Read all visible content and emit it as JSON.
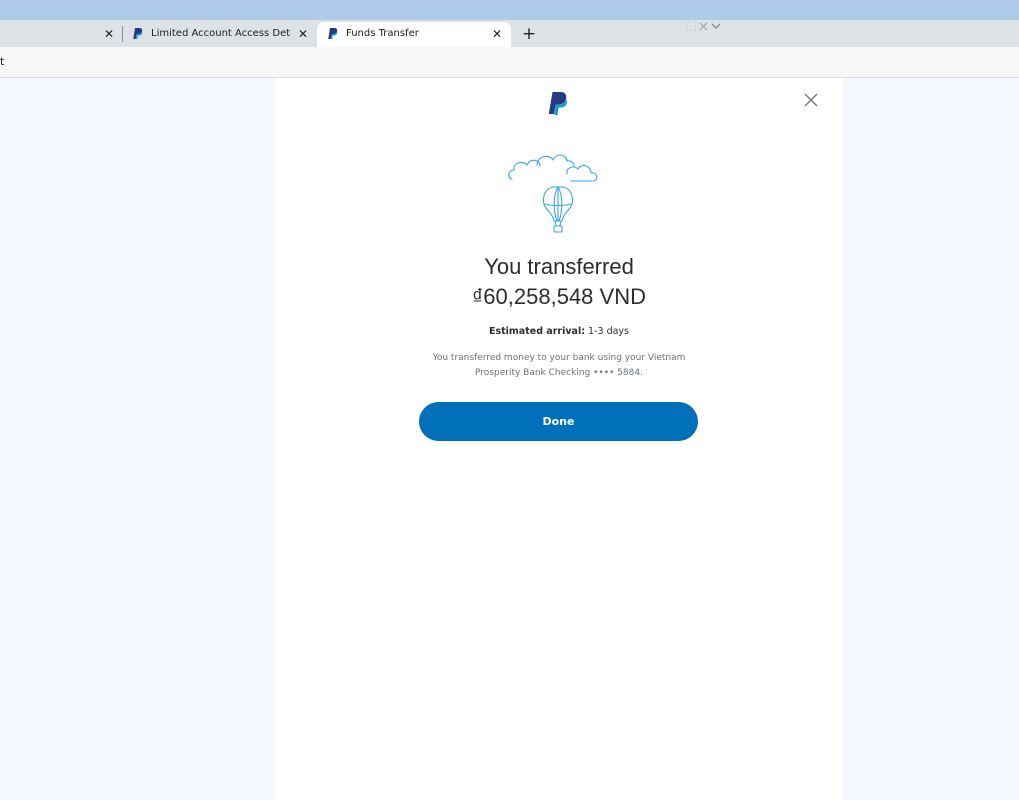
{
  "browser": {
    "tabs": [
      {
        "title": "",
        "close": "✕"
      },
      {
        "title": "Limited Account Access Details -",
        "close": "✕"
      },
      {
        "title": "Funds Transfer",
        "close": "✕",
        "active": true
      }
    ],
    "new_tab": "+",
    "address_text": "t"
  },
  "dialog": {
    "close_icon": "close-icon",
    "heading_line1": "You transferred",
    "heading_line2": "₫60,258,548 VND",
    "arrival_label": "Estimated arrival:",
    "arrival_value": "1-3 days",
    "description": "You transferred money to your bank using your Vietnam Prosperity Bank Checking •••• 5884.",
    "done_label": "Done"
  },
  "colors": {
    "brand_blue": "#0070ba",
    "logo_dark": "#253b80",
    "logo_light": "#179bd7",
    "illustration": "#3aa7dc",
    "page_bg": "#f5f7fe"
  }
}
